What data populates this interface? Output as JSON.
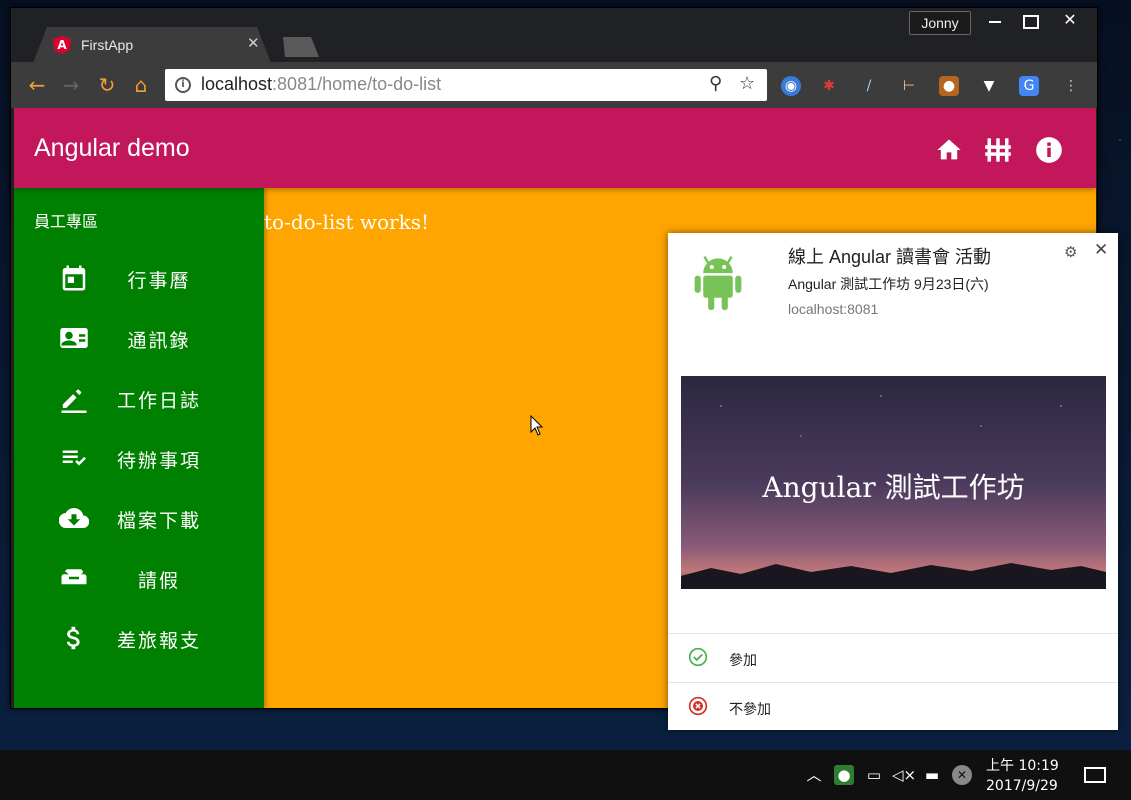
{
  "browser": {
    "profile_name": "Jonny",
    "tab": {
      "title": "FirstApp",
      "favicon": "angular-icon",
      "favicon_letter": "A"
    },
    "url": {
      "host": "localhost",
      "port_path": ":8081/home/to-do-list"
    }
  },
  "app": {
    "title": "Angular demo",
    "toolbar_icons": [
      "home-icon",
      "dashboard-icon",
      "info-icon"
    ],
    "colors": {
      "primary": "#c2185b",
      "sidenav": "#008000",
      "content": "#ffa500"
    },
    "sidenav": {
      "section_title": "員工專區",
      "items": [
        {
          "label": "行事曆",
          "icon": "calendar-icon"
        },
        {
          "label": "通訊錄",
          "icon": "contact-card-icon"
        },
        {
          "label": "工作日誌",
          "icon": "edit-icon"
        },
        {
          "label": "待辦事項",
          "icon": "playlist-check-icon"
        },
        {
          "label": "檔案下載",
          "icon": "cloud-download-icon"
        },
        {
          "label": "請假",
          "icon": "sofa-icon"
        },
        {
          "label": "差旅報支",
          "icon": "dollar-icon"
        }
      ]
    },
    "content_text": "to-do-list works!"
  },
  "notification": {
    "title": "線上 Angular 讀書會 活動",
    "body": "Angular 測試工作坊 9月23日(六)",
    "source": "localhost:8081",
    "image_text": "Angular 測試工作坊",
    "actions": [
      {
        "label": "參加",
        "icon": "check-circle-icon",
        "color": "#4caf50"
      },
      {
        "label": "不參加",
        "icon": "cancel-circle-icon",
        "color": "#d32f2f"
      }
    ]
  },
  "taskbar": {
    "time": "上午 10:19",
    "date": "2017/9/29"
  }
}
